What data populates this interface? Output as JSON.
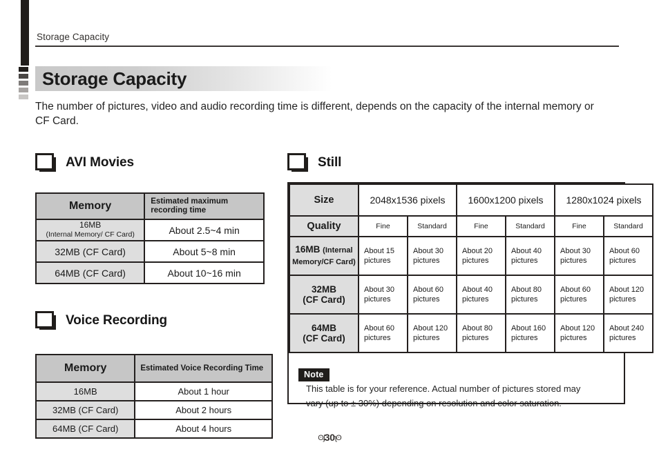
{
  "running_head": "Storage Capacity",
  "title": "Storage Capacity",
  "intro": "The number of pictures, video and audio recording time is different, depends on the capacity of the internal memory or CF Card.",
  "sections": {
    "avi": {
      "heading": "AVI Movies",
      "table": {
        "headers": [
          "Memory",
          "Estimated maximum recording time"
        ],
        "rows": [
          {
            "memory": "16MB",
            "memory_sub": "(Internal Memory/ CF Card)",
            "time": "About 2.5~4 min"
          },
          {
            "memory": "32MB (CF Card)",
            "memory_sub": "",
            "time": "About   5~8  min"
          },
          {
            "memory": "64MB (CF Card)",
            "memory_sub": "",
            "time": "About 10~16 min"
          }
        ]
      }
    },
    "voice": {
      "heading": "Voice Recording",
      "table": {
        "headers": [
          "Memory",
          "Estimated Voice Recording Time"
        ],
        "rows": [
          {
            "memory": "16MB",
            "time": "About 1 hour"
          },
          {
            "memory": "32MB (CF Card)",
            "time": "About 2 hours"
          },
          {
            "memory": "64MB (CF Card)",
            "time": "About 4 hours"
          }
        ]
      }
    },
    "still": {
      "heading": "Still",
      "table": {
        "size_label": "Size",
        "quality_label": "Quality",
        "sizes": [
          "2048x1536 pixels",
          "1600x1200 pixels",
          "1280x1024 pixels"
        ],
        "qualities": [
          "Fine",
          "Standard",
          "Fine",
          "Standard",
          "Fine",
          "Standard"
        ],
        "rows": [
          {
            "memory": "16MB ",
            "memory_sub": "(Internal Memory/CF Card)",
            "cells": [
              "About 15 pictures",
              "About 30 pictures",
              "About 20 pictures",
              "About 40 pictures",
              "About 30 pictures",
              "About 60 pictures"
            ]
          },
          {
            "memory": "32MB",
            "memory_sub": "(CF Card)",
            "cells": [
              "About 30 pictures",
              "About 60 pictures",
              "About 40 pictures",
              "About 80 pictures",
              "About 60 pictures",
              "About 120 pictures"
            ]
          },
          {
            "memory": "64MB",
            "memory_sub": "(CF Card)",
            "cells": [
              "About 60 pictures",
              "About 120 pictures",
              "About 80 pictures",
              "About 160 pictures",
              "About 120 pictures",
              "About 240 pictures"
            ]
          }
        ]
      },
      "note": {
        "badge": "Note",
        "text": "This table is for your reference. Actual number of pictures stored may vary (up to ±  30%) depending on resolution and color saturation."
      }
    }
  },
  "footer": {
    "ornament_left": "ʘʄ",
    "page_number": "30",
    "ornament_right": "ʅʘ"
  },
  "decorations": {
    "left_bar_color": "#201d1b",
    "square_shades": [
      "#201d1b",
      "#4a4745",
      "#7e7b79",
      "#a7a4a2",
      "#c8c6c4"
    ]
  },
  "colors": {
    "header_gray": "#c6c6c6",
    "rowheader_gray": "#dedede",
    "ink": "#231f1e"
  }
}
